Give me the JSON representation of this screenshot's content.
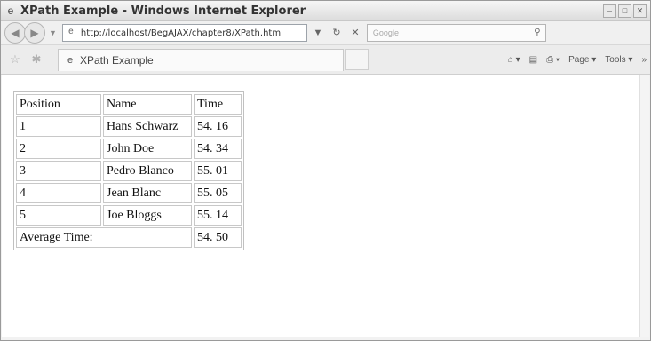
{
  "window": {
    "title": "XPath Example - Windows Internet Explorer",
    "controls": [
      "–",
      "□",
      "✕"
    ]
  },
  "address": {
    "url": "http://localhost/BegAJAX/chapter8/XPath.htm",
    "search_placeholder": "Google"
  },
  "tab": {
    "title": "XPath Example"
  },
  "toolbar": {
    "page_label": "Page",
    "tools_label": "Tools"
  },
  "table": {
    "headers": [
      "Position",
      "Name",
      "Time"
    ],
    "rows": [
      [
        "1",
        "Hans Schwarz",
        "54. 16"
      ],
      [
        "2",
        "John Doe",
        "54. 34"
      ],
      [
        "3",
        "Pedro Blanco",
        "55. 01"
      ],
      [
        "4",
        "Jean Blanc",
        "55. 05"
      ],
      [
        "5",
        "Joe Bloggs",
        "55. 14"
      ]
    ],
    "average_label": "Average Time:",
    "average_value": "54. 50"
  }
}
